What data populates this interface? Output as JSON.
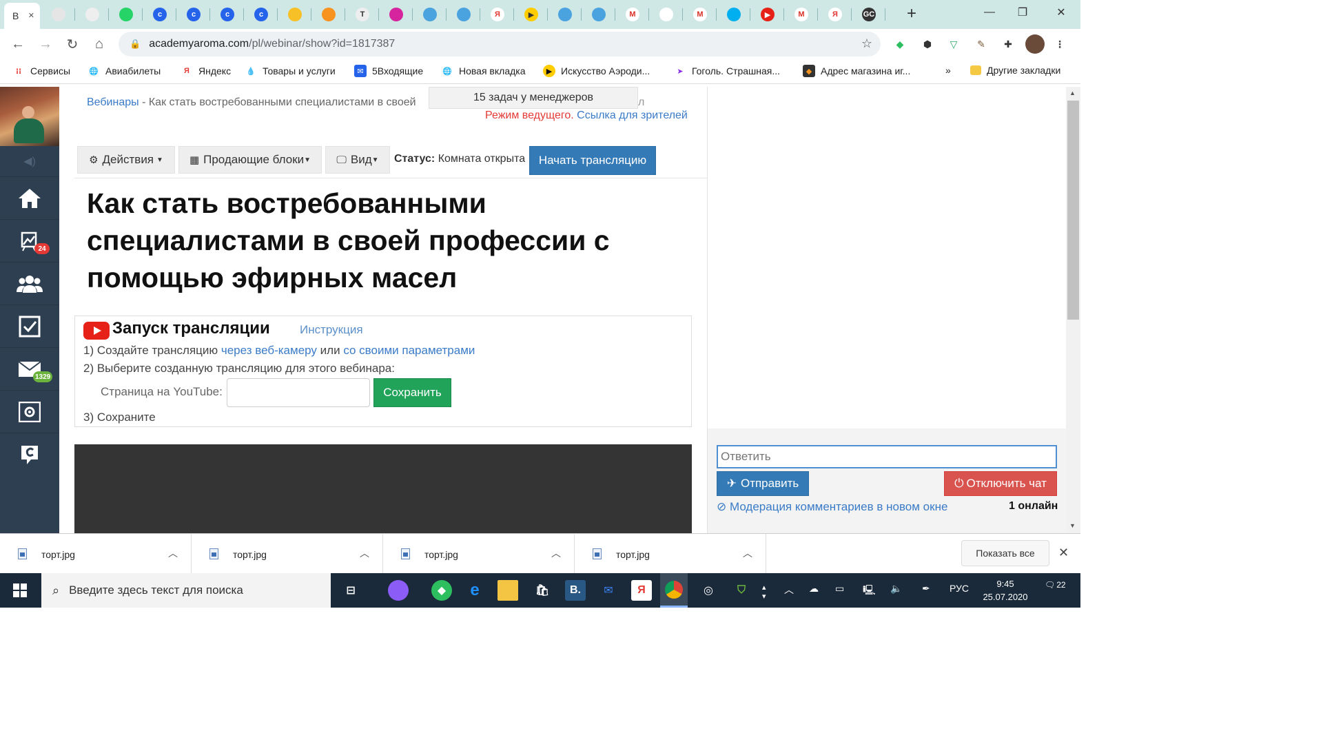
{
  "browser": {
    "tab_first_letter": "В",
    "tab_close_glyph": "✕",
    "new_tab_glyph": "+",
    "window_controls": {
      "minimize": "—",
      "restore": "❐",
      "close": "✕"
    },
    "url_host": "academyaroma.com",
    "url_path": "/pl/webinar/show?id=1817387",
    "favicons": [
      {
        "icon": "smile-icon",
        "color": "#e5e5e5",
        "glyph": ""
      },
      {
        "icon": "chef-icon",
        "color": "#eee",
        "glyph": ""
      },
      {
        "icon": "whatsapp-icon",
        "color": "#25d366",
        "glyph": ""
      },
      {
        "icon": "c-icon",
        "color": "#2563eb",
        "glyph": "c"
      },
      {
        "icon": "c-icon",
        "color": "#2563eb",
        "glyph": "c"
      },
      {
        "icon": "c-icon",
        "color": "#2563eb",
        "glyph": "c"
      },
      {
        "icon": "c-icon",
        "color": "#2563eb",
        "glyph": "c"
      },
      {
        "icon": "emoji-icon",
        "color": "#f6c026",
        "glyph": ""
      },
      {
        "icon": "odnoklassniki-icon",
        "color": "#f7931e",
        "glyph": ""
      },
      {
        "icon": "t-icon",
        "color": "#eee",
        "glyph": "T"
      },
      {
        "icon": "instagram-icon",
        "color": "#d6249f",
        "glyph": ""
      },
      {
        "icon": "chat-bubble-icon",
        "color": "#4aa3df",
        "glyph": ""
      },
      {
        "icon": "chat-bubble-icon",
        "color": "#4aa3df",
        "glyph": ""
      },
      {
        "icon": "yandex-icon",
        "color": "#fff",
        "glyph": "Я"
      },
      {
        "icon": "play-yellow-icon",
        "color": "#fc0",
        "glyph": "▶"
      },
      {
        "icon": "chat-bubble-icon",
        "color": "#4aa3df",
        "glyph": ""
      },
      {
        "icon": "chat-bubble-icon",
        "color": "#4aa3df",
        "glyph": ""
      },
      {
        "icon": "gmail-icon",
        "color": "#fff",
        "glyph": "M"
      },
      {
        "icon": "pdf-icon",
        "color": "#fff",
        "glyph": ""
      },
      {
        "icon": "gmail-icon",
        "color": "#fff",
        "glyph": "M"
      },
      {
        "icon": "skype-icon",
        "color": "#00aff0",
        "glyph": ""
      },
      {
        "icon": "youtube-icon",
        "color": "#e62117",
        "glyph": "▶"
      },
      {
        "icon": "gmail-icon",
        "color": "#fff",
        "glyph": "M"
      },
      {
        "icon": "yandex-icon",
        "color": "#fff",
        "glyph": "Я"
      },
      {
        "icon": "gc-icon",
        "color": "#333",
        "glyph": "GC"
      }
    ],
    "bookmarks": [
      {
        "label": "Сервисы",
        "icon": "apps-grid-icon"
      },
      {
        "label": "Авиабилеты",
        "icon": "globe-icon"
      },
      {
        "label": "Яндекс",
        "icon": "yandex-icon"
      },
      {
        "label": "Товары и услуги",
        "icon": "drops-icon"
      },
      {
        "label": "5Входящие",
        "icon": "mail-icon"
      },
      {
        "label": "Новая вкладка",
        "icon": "globe-icon"
      },
      {
        "label": "Искусство Аэроди...",
        "icon": "play-yellow-icon"
      },
      {
        "label": "Гоголь. Страшная...",
        "icon": "purple-arrow-icon"
      },
      {
        "label": "Адрес магазина иг...",
        "icon": "orange-diamond-icon"
      }
    ],
    "bookmarks_more": "»",
    "other_bookmarks": "Другие закладки"
  },
  "sidebar": {
    "items": [
      {
        "name": "home",
        "badge": ""
      },
      {
        "name": "webinars",
        "badge": "24"
      },
      {
        "name": "users",
        "badge": ""
      },
      {
        "name": "tasks",
        "badge": ""
      },
      {
        "name": "messages",
        "badge": "1329"
      },
      {
        "name": "settings",
        "badge": ""
      },
      {
        "name": "getcourse",
        "badge": ""
      }
    ]
  },
  "page": {
    "breadcrumb_link": "Вебинары",
    "breadcrumb_sep": " - ",
    "breadcrumb_current": "Как стать востребованными специалистами в своей",
    "tooltip": "15 задач у менеджеров",
    "tooltip_tail": "л",
    "host_mode": "Режим ведущего.",
    "viewer_link": "Ссылка для зрителей",
    "toolbar": {
      "actions": "Действия",
      "selling_blocks": "Продающие блоки",
      "view": "Вид",
      "status_label": "Статус:",
      "status_value": "Комната открыта",
      "start_broadcast": "Начать трансляцию"
    },
    "title": "Как стать востребованными специалистами в своей профессии с помощью эфирных масел",
    "youtube": {
      "heading": "Запуск трансляции",
      "instruction": "Инструкция",
      "step1_prefix": "1) Создайте трансляцию",
      "step1_link1": "через веб-камеру",
      "step1_or": "или",
      "step1_link2": "со своими параметрами",
      "step2": "2) Выберите созданную трансляцию для этого вебинара:",
      "page_label": "Страница на YouTube:",
      "page_value": "",
      "save": "Сохранить",
      "step3": "3) Сохраните"
    }
  },
  "chat": {
    "reply_placeholder": "Ответить",
    "send": "Отправить",
    "disable_chat": "Отключить чат",
    "moderation": "Модерация комментариев в новом окне",
    "online": "1 онлайн"
  },
  "downloads": {
    "files": [
      "торт.jpg",
      "торт.jpg",
      "торт.jpg",
      "торт.jpg"
    ],
    "show_all": "Показать все",
    "close": "✕"
  },
  "taskbar": {
    "search_placeholder": "Введите здесь текст для поиска",
    "language": "РУС",
    "time": "9:45",
    "date": "25.07.2020",
    "notifications": "22"
  }
}
